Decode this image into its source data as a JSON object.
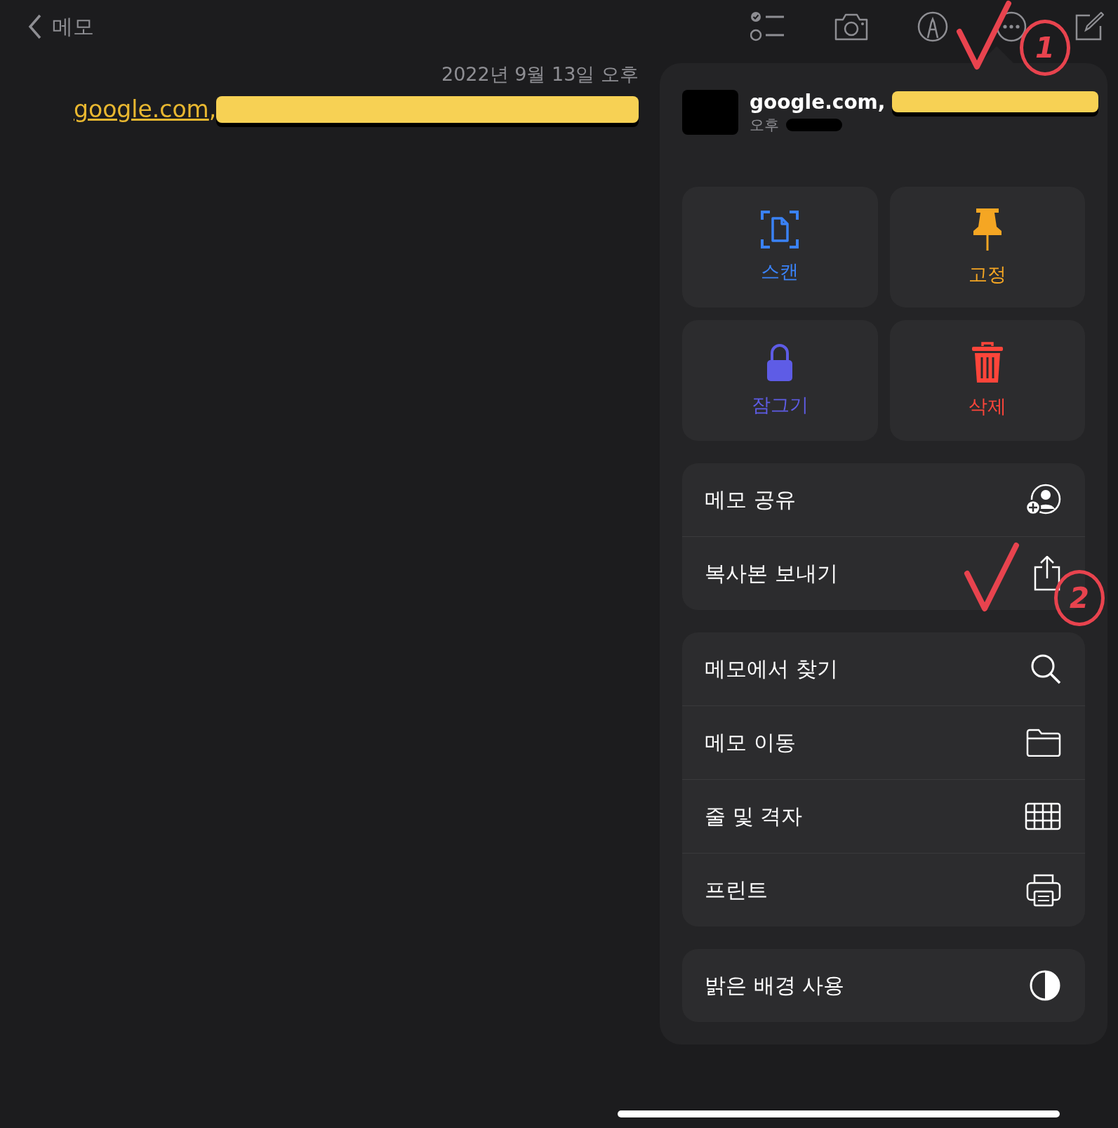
{
  "toolbar": {
    "back_label": "메모",
    "buttons": [
      {
        "kind": "checklist"
      },
      {
        "kind": "camera"
      },
      {
        "kind": "markup"
      },
      {
        "kind": "more"
      },
      {
        "kind": "compose"
      }
    ]
  },
  "note": {
    "date": "2022년 9월 13일 오후",
    "link": "google.com",
    "after_link": ",",
    "redacted": true
  },
  "popover": {
    "title": "google.com,",
    "title_redacted": true,
    "subtitle": "오후",
    "subtitle_redacted": true,
    "tiles": [
      {
        "label": "스캔",
        "kind": "scan",
        "color": "#3a82f7"
      },
      {
        "label": "고정",
        "kind": "pin",
        "color": "#f5a623"
      },
      {
        "label": "잠그기",
        "kind": "lock",
        "color": "#5e5ce6"
      },
      {
        "label": "삭제",
        "kind": "trash",
        "color": "#ff453a"
      }
    ],
    "groups": [
      [
        {
          "label": "메모 공유",
          "kind": "share-person"
        },
        {
          "label": "복사본 보내기",
          "kind": "share"
        }
      ],
      [
        {
          "label": "메모에서 찾기",
          "kind": "search"
        },
        {
          "label": "메모 이동",
          "kind": "folder"
        },
        {
          "label": "줄 및 격자",
          "kind": "grid"
        },
        {
          "label": "프린트",
          "kind": "print"
        }
      ],
      [
        {
          "label": "밝은 배경 사용",
          "kind": "contrast"
        }
      ]
    ]
  },
  "annotations": [
    {
      "kind": "check"
    },
    {
      "kind": "number",
      "label": "1"
    },
    {
      "kind": "check"
    },
    {
      "kind": "number",
      "label": "2"
    }
  ]
}
